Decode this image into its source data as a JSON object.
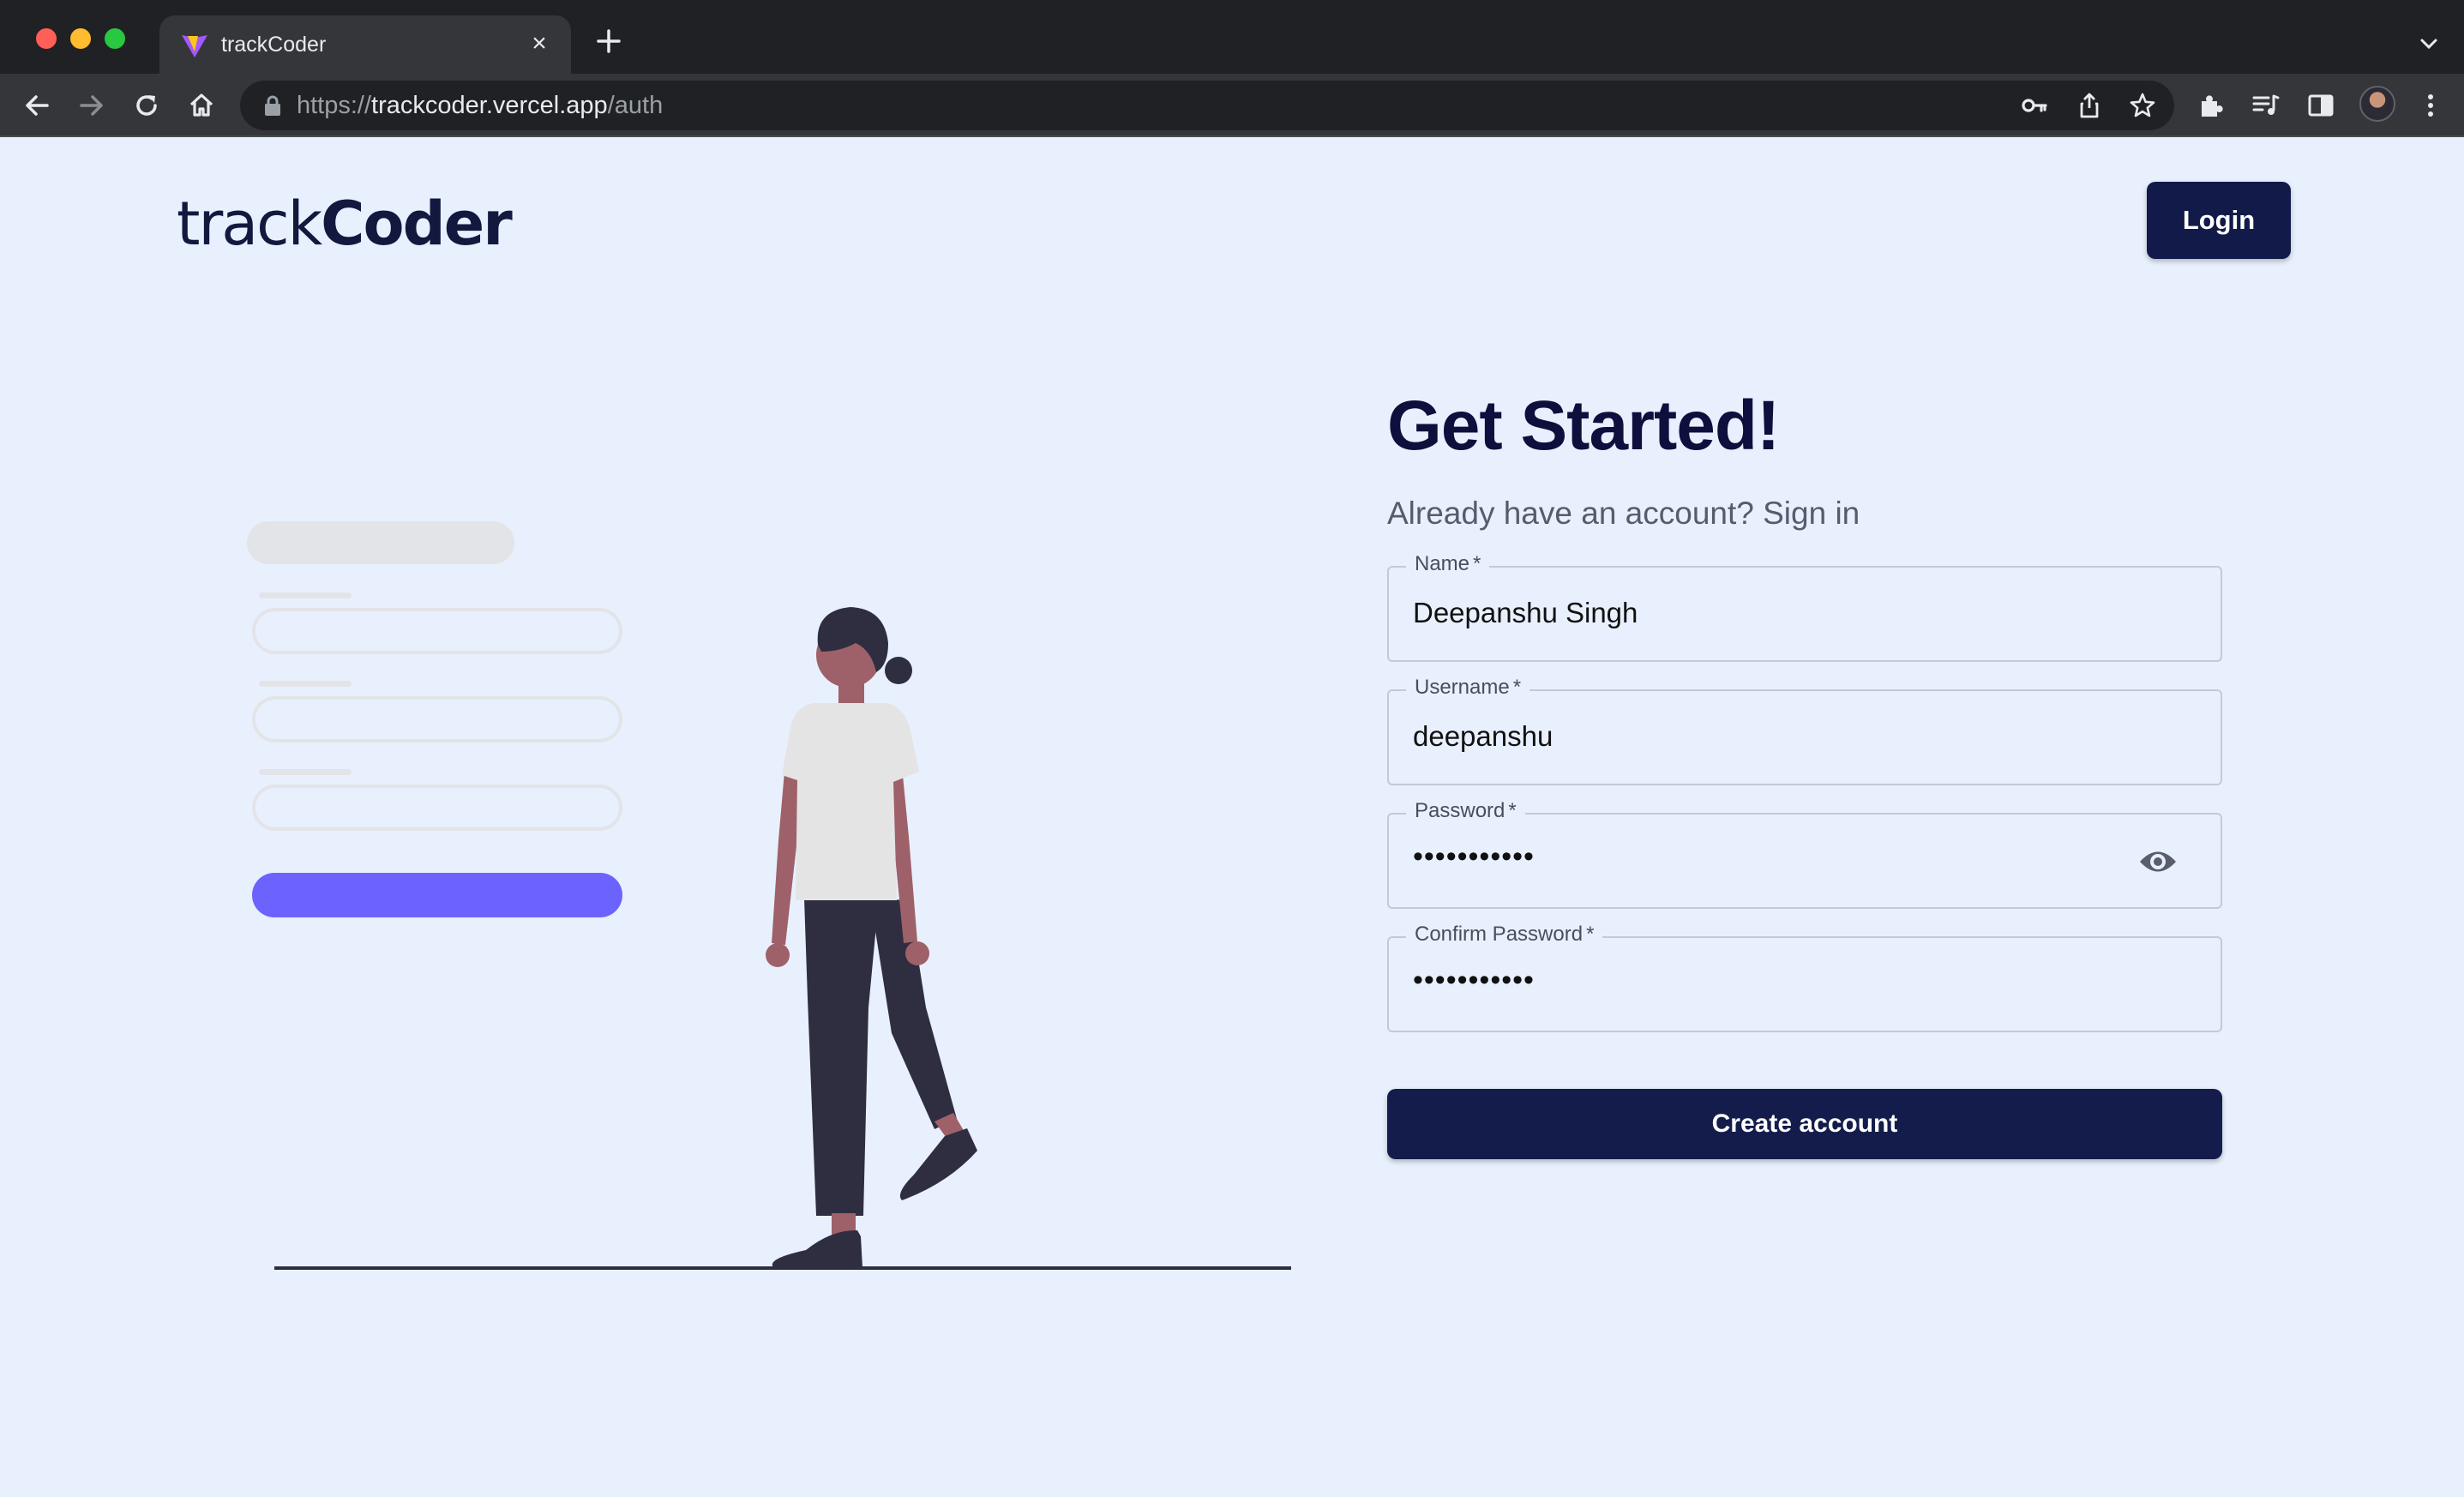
{
  "browser": {
    "tab_title": "trackCoder",
    "url_scheme": "https://",
    "url_host": "trackcoder.vercel.app",
    "url_path": "/auth",
    "icons": [
      "back-icon",
      "forward-icon",
      "reload-icon",
      "home-icon",
      "lock-icon",
      "key-icon",
      "share-icon",
      "star-icon",
      "extensions-icon",
      "media-icon",
      "side-panel-icon",
      "profile-avatar",
      "menu-icon",
      "new-tab-icon",
      "tab-close-icon",
      "tab-list-icon"
    ]
  },
  "header": {
    "logo_light": "track",
    "logo_bold": "Coder",
    "login_label": "Login"
  },
  "form": {
    "title": "Get Started!",
    "subtitle": "Already have an account? Sign in",
    "fields": [
      {
        "label": "Name",
        "required": "*",
        "value": "Deepanshu Singh"
      },
      {
        "label": "Username",
        "required": "*",
        "value": "deepanshu"
      },
      {
        "label": "Password",
        "required": "*",
        "value": "•••••••••••"
      },
      {
        "label": "Confirm Password",
        "required": "*",
        "value": "•••••••••••"
      }
    ],
    "submit_label": "Create account"
  },
  "colors": {
    "page_background": "#e8f0fd",
    "brand_navy": "#121a49",
    "illustration_accent": "#6c63ff"
  }
}
